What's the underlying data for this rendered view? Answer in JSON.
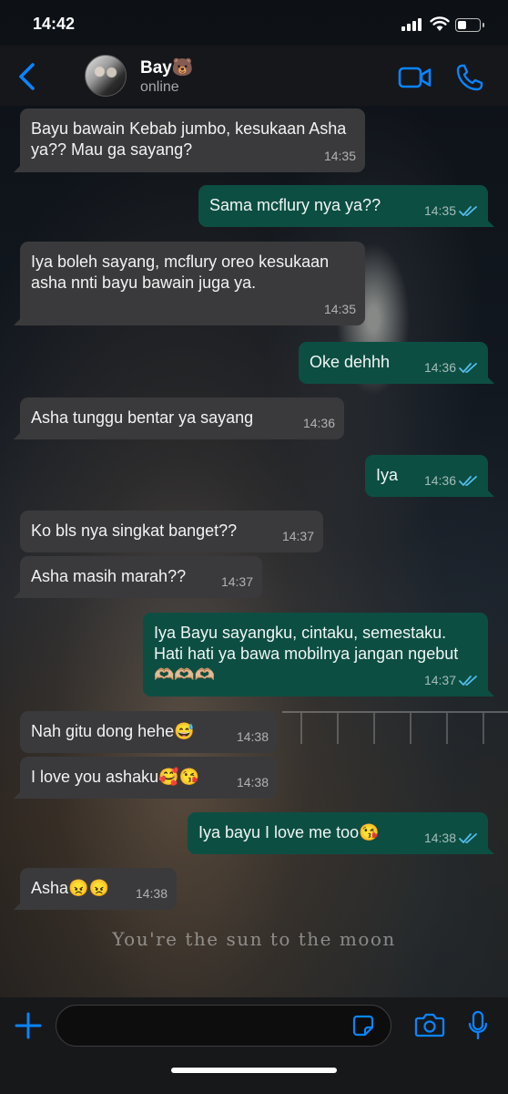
{
  "status_bar": {
    "time": "14:42"
  },
  "header": {
    "contact_name": "Bay🐻",
    "contact_status": "online"
  },
  "wallpaper_caption": "You're the sun to the moon",
  "messages": [
    {
      "dir": "in",
      "text": "Bayu bawain Kebab jumbo, kesukaan Asha ya?? Mau ga sayang?",
      "time": "14:35"
    },
    {
      "dir": "out",
      "text": "Sama mcflury nya ya??",
      "time": "14:35",
      "read": true
    },
    {
      "dir": "in",
      "text": "Iya boleh sayang, mcflury oreo kesukaan asha nnti bayu bawain juga ya.",
      "time": "14:35"
    },
    {
      "dir": "out",
      "text": "Oke dehhh",
      "time": "14:36",
      "read": true
    },
    {
      "dir": "in",
      "text": "Asha tunggu bentar ya sayang",
      "time": "14:36"
    },
    {
      "dir": "out",
      "text": "Iya",
      "time": "14:36",
      "read": true
    },
    {
      "dir": "in",
      "text": "Ko bls nya singkat banget??",
      "time": "14:37"
    },
    {
      "dir": "in",
      "text": "Asha masih marah??",
      "time": "14:37"
    },
    {
      "dir": "out",
      "text": "Iya Bayu sayangku, cintaku, semestaku. Hati hati ya bawa mobilnya jangan ngebut🫶🏼🫶🏼🫶🏼",
      "time": "14:37",
      "read": true
    },
    {
      "dir": "in",
      "text": "Nah gitu dong hehe😅",
      "time": "14:38"
    },
    {
      "dir": "in",
      "text": "I love you ashaku🥰😘",
      "time": "14:38"
    },
    {
      "dir": "out",
      "text": "Iya bayu I love me too😘",
      "time": "14:38",
      "read": true
    },
    {
      "dir": "in",
      "text": "Asha😠😠",
      "time": "14:38"
    }
  ],
  "colors": {
    "accent": "#0a84ff",
    "outgoing_bubble": "#0d4e43",
    "incoming_bubble": "#3a3a3c",
    "read_ticks": "#53bdeb"
  }
}
